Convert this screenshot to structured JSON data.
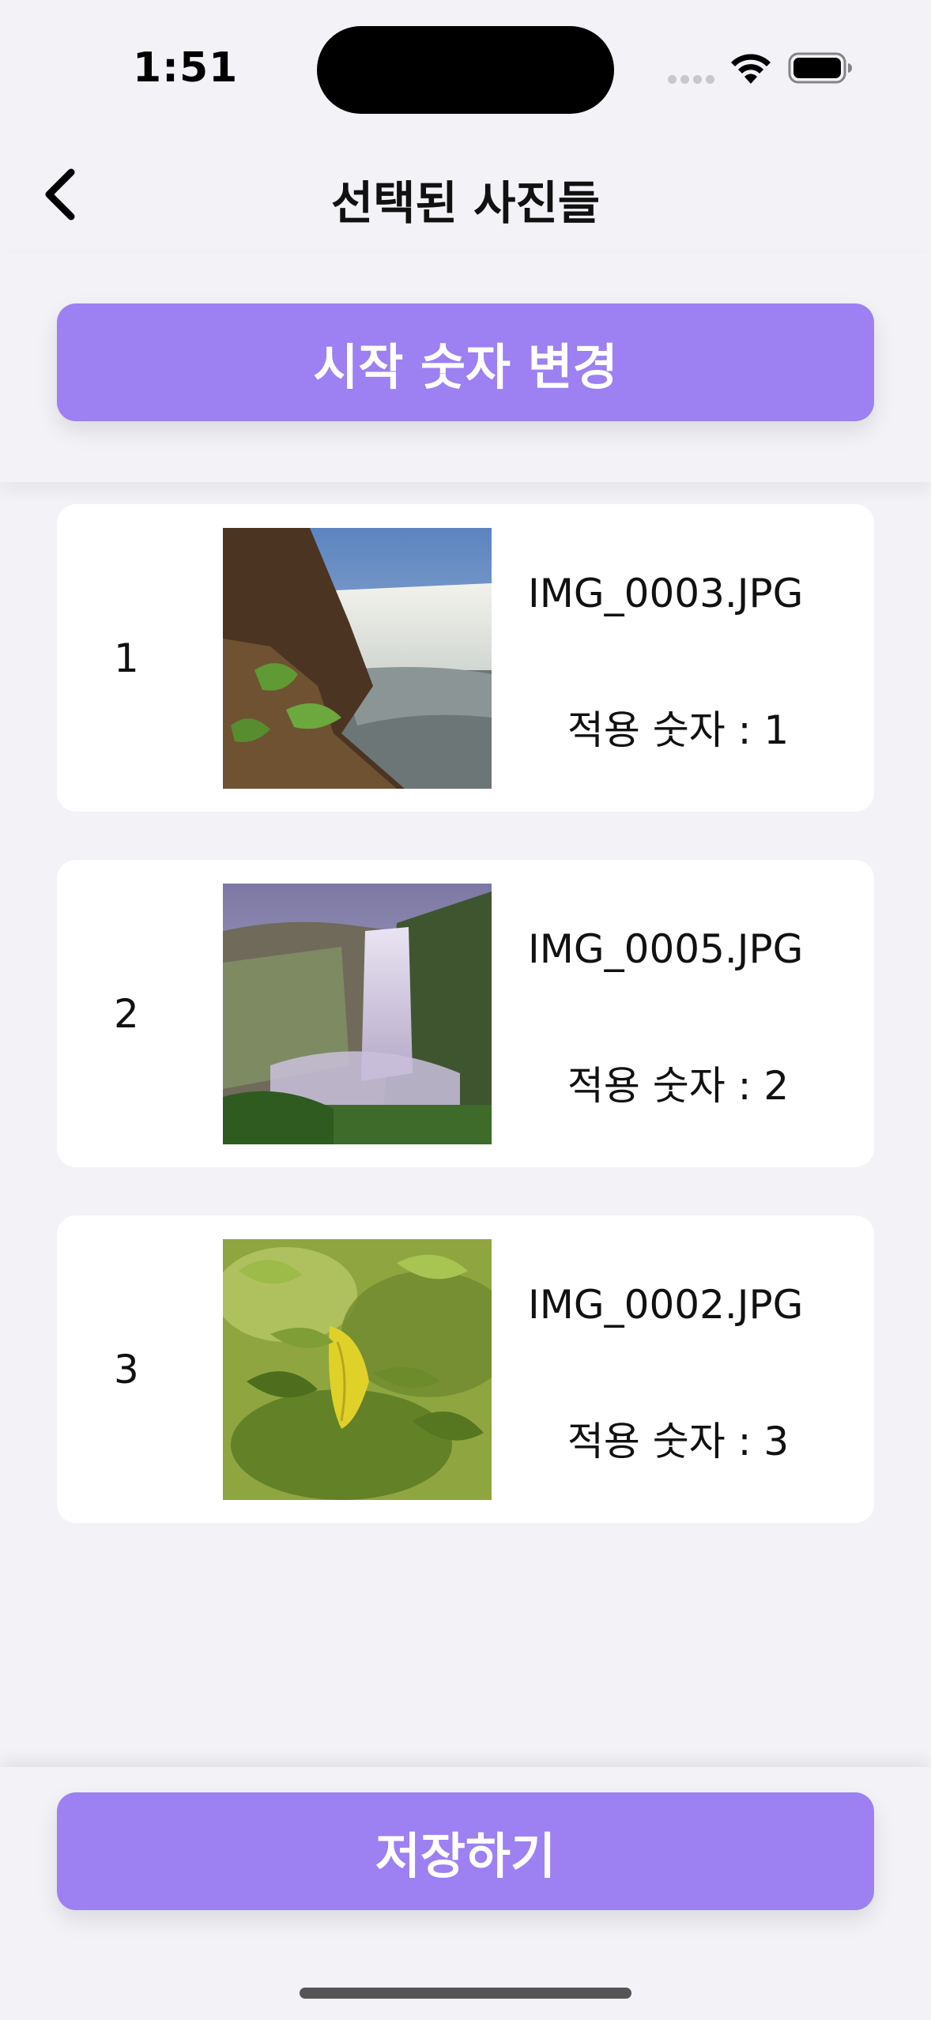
{
  "status_bar": {
    "time": "1:51"
  },
  "header": {
    "title": "선택된 사진들"
  },
  "toolbar": {
    "start_number_label": "시작 숫자 변경"
  },
  "photos": [
    {
      "index": "1",
      "file_name": "IMG_0003.JPG",
      "applied_number": "적용 숫자 : 1"
    },
    {
      "index": "2",
      "file_name": "IMG_0005.JPG",
      "applied_number": "적용 숫자 : 2"
    },
    {
      "index": "3",
      "file_name": "IMG_0002.JPG",
      "applied_number": "적용 숫자 : 3"
    }
  ],
  "footer": {
    "save_label": "저장하기"
  },
  "colors": {
    "accent": "#9d80f2",
    "background": "#f2f2f7",
    "card": "#ffffff"
  },
  "icons": {
    "back": "chevron-left-icon",
    "wifi": "wifi-icon",
    "battery": "battery-icon"
  }
}
